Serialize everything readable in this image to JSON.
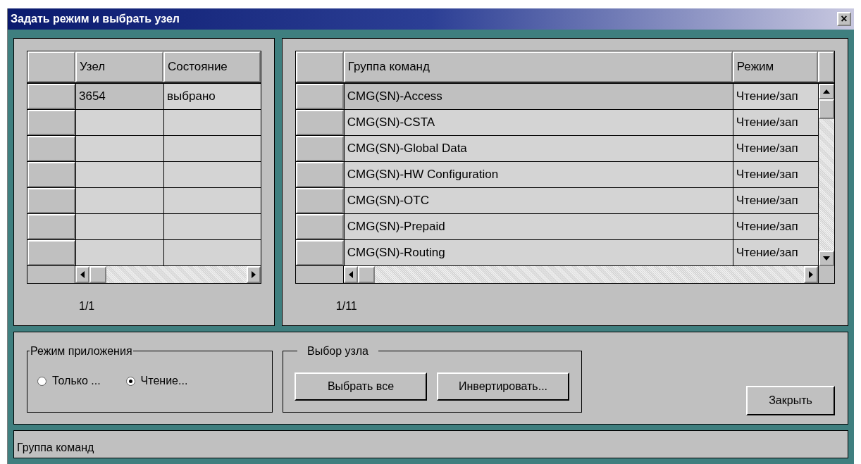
{
  "window": {
    "title": "Задать режим и выбрать узел",
    "close": "×"
  },
  "nodes_table": {
    "columns": [
      "Узел",
      "Состояние"
    ],
    "rows": [
      {
        "cells": [
          "3654",
          "выбрано"
        ],
        "selected": true
      },
      {
        "cells": [
          "",
          ""
        ],
        "selected": false
      },
      {
        "cells": [
          "",
          ""
        ],
        "selected": false
      },
      {
        "cells": [
          "",
          ""
        ],
        "selected": false
      },
      {
        "cells": [
          "",
          ""
        ],
        "selected": false
      },
      {
        "cells": [
          "",
          ""
        ],
        "selected": false
      },
      {
        "cells": [
          "",
          ""
        ],
        "selected": false
      }
    ],
    "pager": "1/1"
  },
  "groups_table": {
    "columns": [
      "Группа команд",
      "Режим"
    ],
    "rows": [
      {
        "cells": [
          "CMG(SN)-Access",
          "Чтение/зап"
        ],
        "selected": true
      },
      {
        "cells": [
          "CMG(SN)-CSTA",
          "Чтение/зап"
        ],
        "selected": false
      },
      {
        "cells": [
          "CMG(SN)-Global Data",
          "Чтение/зап"
        ],
        "selected": false
      },
      {
        "cells": [
          "CMG(SN)-HW Configuration",
          "Чтение/зап"
        ],
        "selected": false
      },
      {
        "cells": [
          "CMG(SN)-OTC",
          "Чтение/зап"
        ],
        "selected": false
      },
      {
        "cells": [
          "CMG(SN)-Prepaid",
          "Чтение/зап"
        ],
        "selected": false
      },
      {
        "cells": [
          "CMG(SN)-Routing",
          "Чтение/зап"
        ],
        "selected": false
      }
    ],
    "pager": "1/11"
  },
  "app_mode": {
    "title": "Режим приложения",
    "options": [
      {
        "label": "Только ...",
        "selected": false
      },
      {
        "label": "Чтение...",
        "selected": true
      }
    ]
  },
  "node_select": {
    "title": "Выбор узла",
    "buttons": [
      "Выбрать все",
      "Инвертировать..."
    ]
  },
  "close_button": "Закрыть",
  "status_bar": "Группа команд"
}
